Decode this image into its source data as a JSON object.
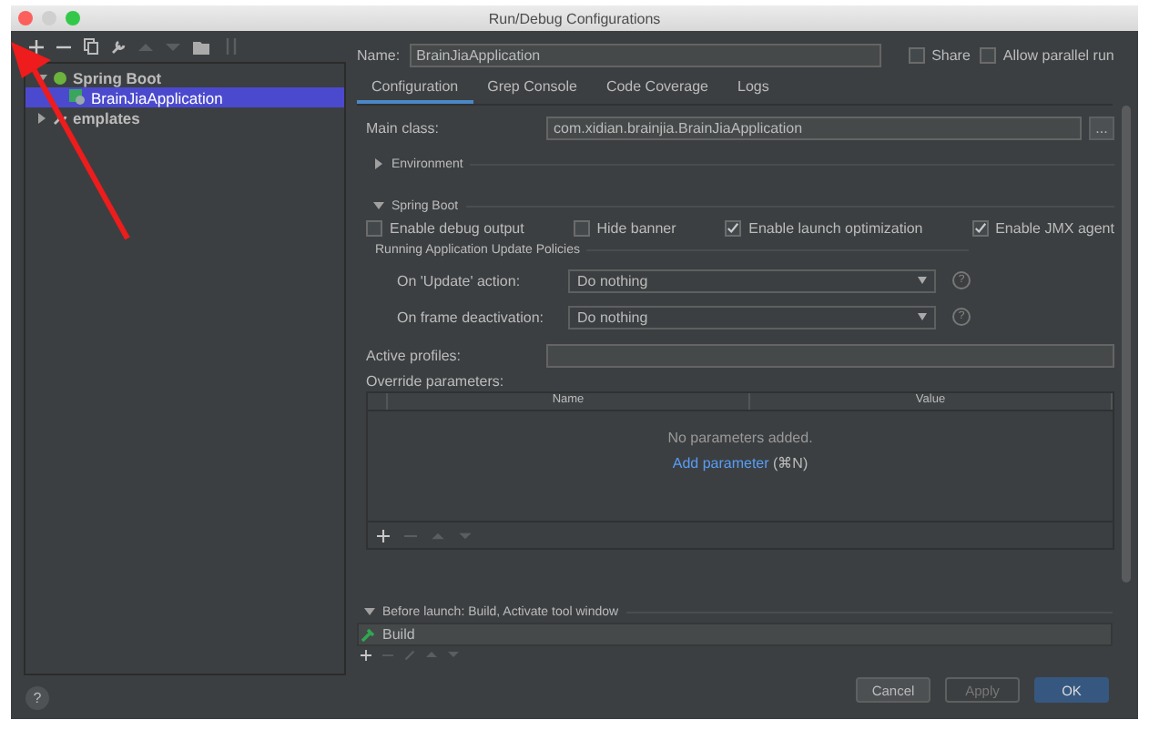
{
  "window": {
    "title": "Run/Debug Configurations"
  },
  "tree": [
    {
      "label": "Spring Boot",
      "expanded": true,
      "selected": false,
      "children": [
        {
          "label": "BrainJiaApplication",
          "selected": true
        }
      ]
    },
    {
      "label": "emplates",
      "expanded": false,
      "selected": false
    }
  ],
  "name": {
    "label": "Name:",
    "value": "BrainJiaApplication"
  },
  "options": [
    {
      "label": "Share",
      "checked": false
    },
    {
      "label": "Allow parallel run",
      "checked": false
    }
  ],
  "tabs": [
    {
      "label": "Configuration",
      "selected": true
    },
    {
      "label": "Grep Console",
      "selected": false
    },
    {
      "label": "Code Coverage",
      "selected": false
    },
    {
      "label": "Logs",
      "selected": false
    }
  ],
  "main_class": {
    "label": "Main class:",
    "value": "com.xidian.brainjia.BrainJiaApplication",
    "browse": "..."
  },
  "environment": {
    "label": "Environment",
    "expanded": false
  },
  "spring_boot": {
    "label": "Spring Boot",
    "expanded": true
  },
  "spring_options": [
    {
      "label": "Enable debug output",
      "checked": false
    },
    {
      "label": "Hide banner",
      "checked": false
    },
    {
      "label": "Enable launch optimization",
      "checked": true
    },
    {
      "label": "Enable JMX agent",
      "checked": true
    }
  ],
  "policies": {
    "title": "Running Application Update Policies",
    "fields": [
      {
        "label": "On 'Update' action:",
        "value": "Do nothing",
        "help": "?"
      },
      {
        "label": "On frame deactivation:",
        "value": "Do nothing",
        "help": "?"
      }
    ]
  },
  "active_profiles": {
    "label": "Active profiles:"
  },
  "override": {
    "label": "Override parameters:",
    "columns": [
      "Name",
      "Value"
    ],
    "empty_text": "No parameters added.",
    "add_link": "Add parameter",
    "shortcut": "(⌘N)"
  },
  "before_launch": {
    "label": "Before launch: Build, Activate tool window",
    "expanded": true,
    "tasks": [
      {
        "label": "Build"
      }
    ]
  },
  "help": "?",
  "buttons": [
    {
      "label": "Cancel",
      "disabled": false,
      "default": false
    },
    {
      "label": "Apply",
      "disabled": true,
      "default": false
    },
    {
      "label": "OK",
      "disabled": false,
      "default": true
    }
  ]
}
